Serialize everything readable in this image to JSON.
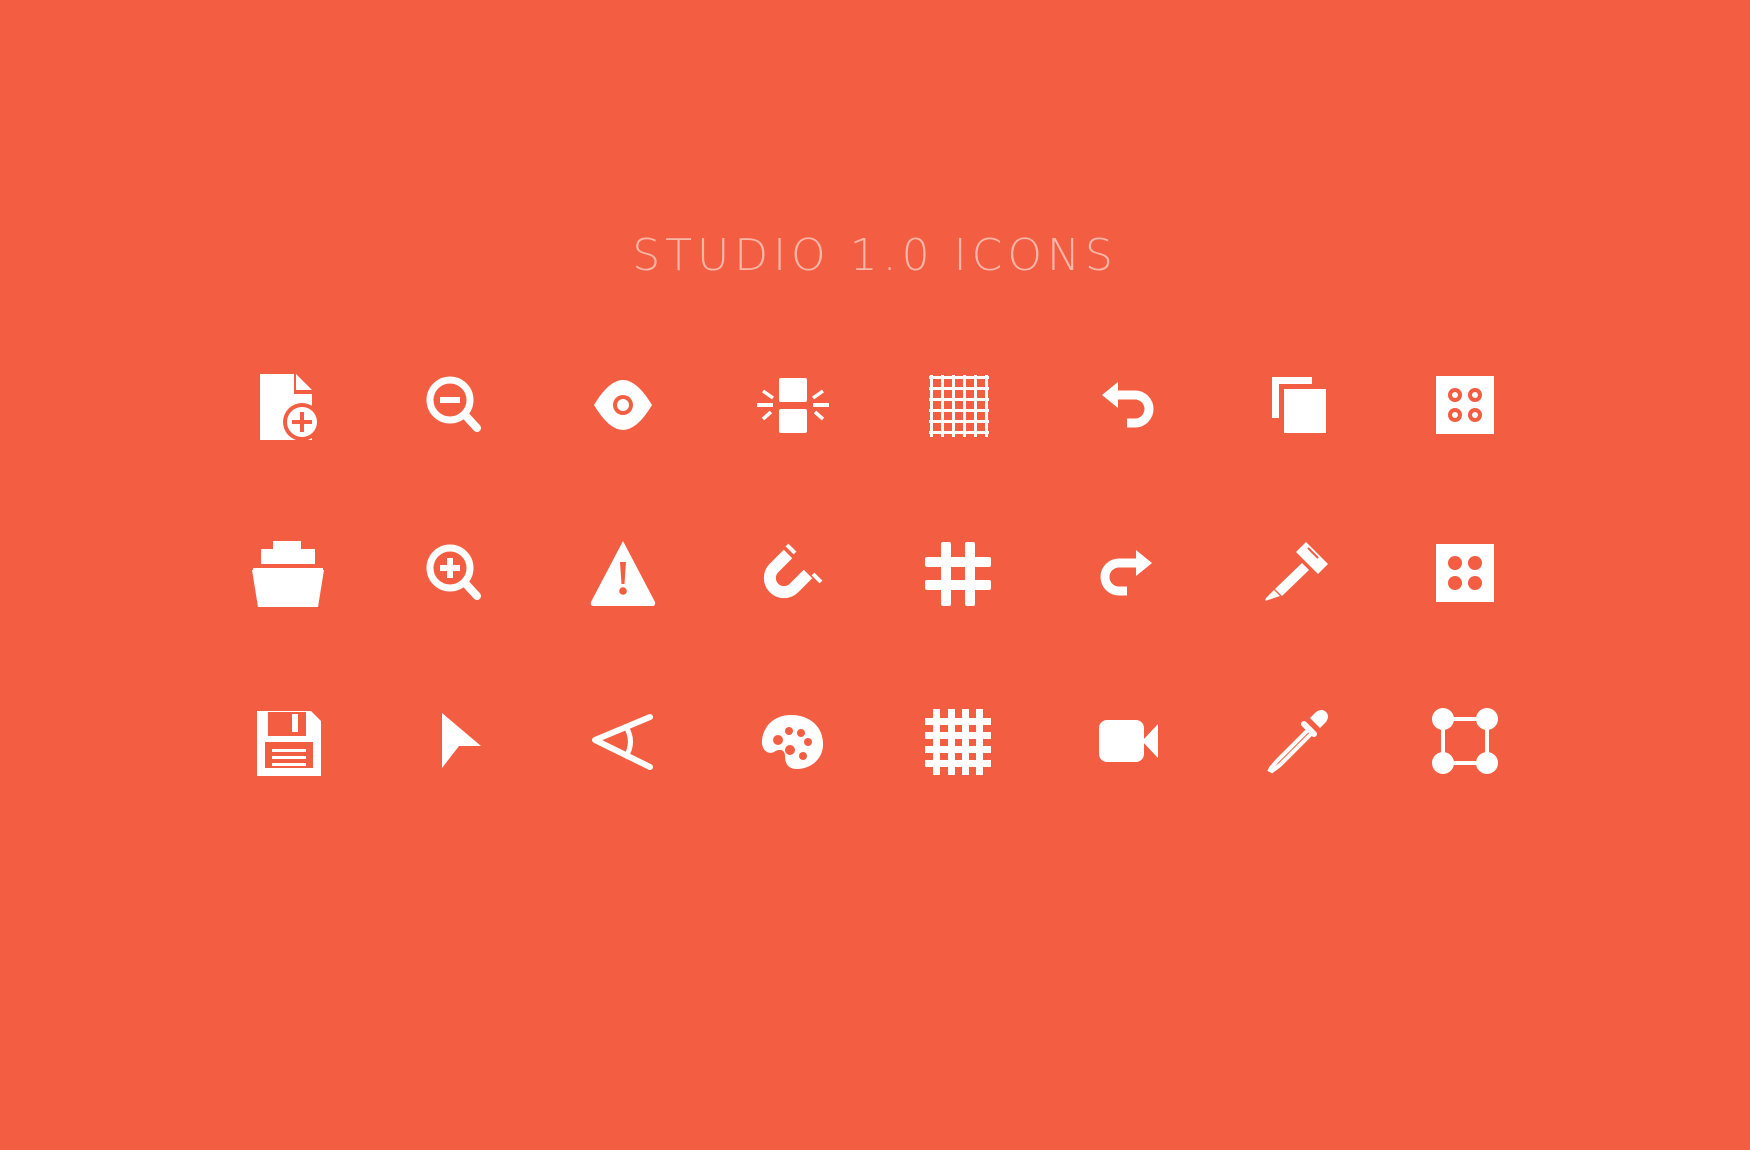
{
  "page": {
    "title": "STUDIO 1.0 ICONS",
    "background_color": "#F35E42",
    "title_color": "#F9B7A9",
    "icon_color": "#FFFFFF"
  },
  "icons": [
    [
      "new-document-icon",
      "zoom-out-icon",
      "view-eye-icon",
      "align-center-icon",
      "grid-icon",
      "undo-icon",
      "duplicate-icon",
      "texture-dots-icon"
    ],
    [
      "open-folder-icon",
      "zoom-in-icon",
      "warning-icon",
      "magnet-snap-icon",
      "hash-grid-icon",
      "redo-icon",
      "paint-brush-icon",
      "texture-circles-icon"
    ],
    [
      "save-icon",
      "pointer-cursor-icon",
      "angle-tool-icon",
      "color-palette-icon",
      "bold-grid-icon",
      "video-camera-icon",
      "eyedropper-icon",
      "node-graph-icon"
    ]
  ]
}
